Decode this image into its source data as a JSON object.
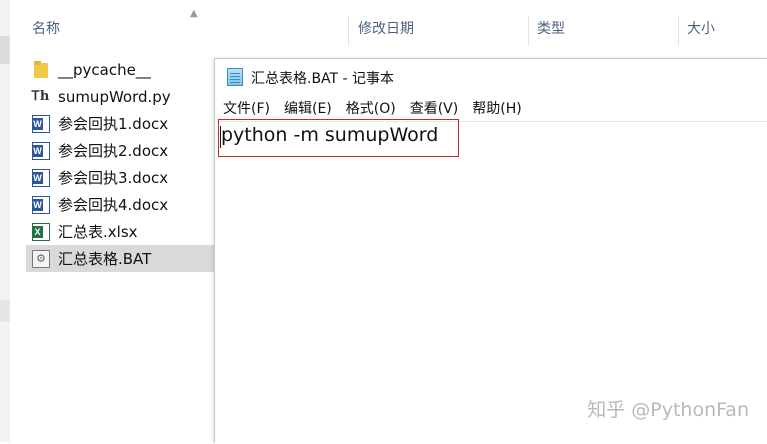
{
  "explorer": {
    "columns": {
      "name": "名称",
      "date_modified": "修改日期",
      "type": "类型",
      "size": "大小"
    },
    "files": [
      {
        "name": "__pycache__",
        "icon": "folder-icon"
      },
      {
        "name": "sumupWord.py",
        "icon": "python-file-icon"
      },
      {
        "name": "参会回执1.docx",
        "icon": "word-doc-icon"
      },
      {
        "name": "参会回执2.docx",
        "icon": "word-doc-icon"
      },
      {
        "name": "参会回执3.docx",
        "icon": "word-doc-icon"
      },
      {
        "name": "参会回执4.docx",
        "icon": "word-doc-icon"
      },
      {
        "name": "汇总表.xlsx",
        "icon": "excel-file-icon"
      },
      {
        "name": "汇总表格.BAT",
        "icon": "batch-file-icon",
        "selected": true
      }
    ]
  },
  "notepad": {
    "title": "汇总表格.BAT - 记事本",
    "menu": [
      "文件(F)",
      "编辑(E)",
      "格式(O)",
      "查看(V)",
      "帮助(H)"
    ],
    "content": "python -m sumupWord",
    "highlight_color": "#c0292e"
  },
  "watermark": "知乎 @PythonFan"
}
